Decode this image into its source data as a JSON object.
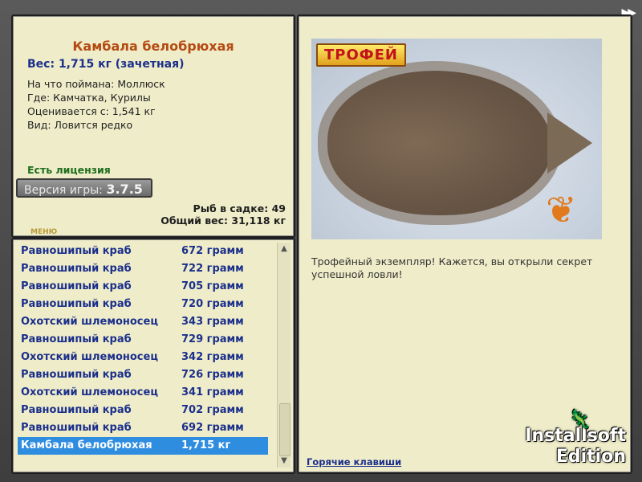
{
  "topbar": {
    "next_icon": "fast-forward-icon"
  },
  "fish": {
    "name": "Камбала белобрюхая",
    "weight_line": "Вес: 1,715 кг (зачетная)",
    "caught_with": "На что поймана: Моллюск",
    "where": "Где: Камчатка, Курилы",
    "valued_from": "Оценивается с: 1,541 кг",
    "kind": "Вид: Ловится редко"
  },
  "license": "Есть лицензия",
  "version": {
    "label": "Версия игры:",
    "number": "3.7.5"
  },
  "stats": {
    "fish_count": "Рыб в садке: 49",
    "total_weight": "Общий вес: 31,118 кг"
  },
  "small_logo": "МЕНЮ",
  "catch_list": [
    {
      "name": "Равношипый краб",
      "weight": "672 грамм"
    },
    {
      "name": "Равношипый краб",
      "weight": "722 грамм"
    },
    {
      "name": "Равношипый краб",
      "weight": "705 грамм"
    },
    {
      "name": "Равношипый краб",
      "weight": "720 грамм"
    },
    {
      "name": "Охотский шлемоносец",
      "weight": "343 грамм"
    },
    {
      "name": "Равношипый краб",
      "weight": "729 грамм"
    },
    {
      "name": "Охотский шлемоносец",
      "weight": "342 грамм"
    },
    {
      "name": "Равношипый краб",
      "weight": "726 грамм"
    },
    {
      "name": "Охотский шлемоносец",
      "weight": "341 грамм"
    },
    {
      "name": "Равношипый краб",
      "weight": "702 грамм"
    },
    {
      "name": "Равношипый краб",
      "weight": "692 грамм"
    },
    {
      "name": "Камбала белобрюхая",
      "weight": "1,715 кг",
      "selected": true
    }
  ],
  "photo": {
    "badge": "ТРОФЕЙ"
  },
  "description": "Трофейный экземпляр! Кажется, вы открыли секрет успешной ловли!",
  "hotkeys_link": "Горячие клавиши",
  "watermark": {
    "line1": "Installsoft",
    "line2": "Edition"
  }
}
